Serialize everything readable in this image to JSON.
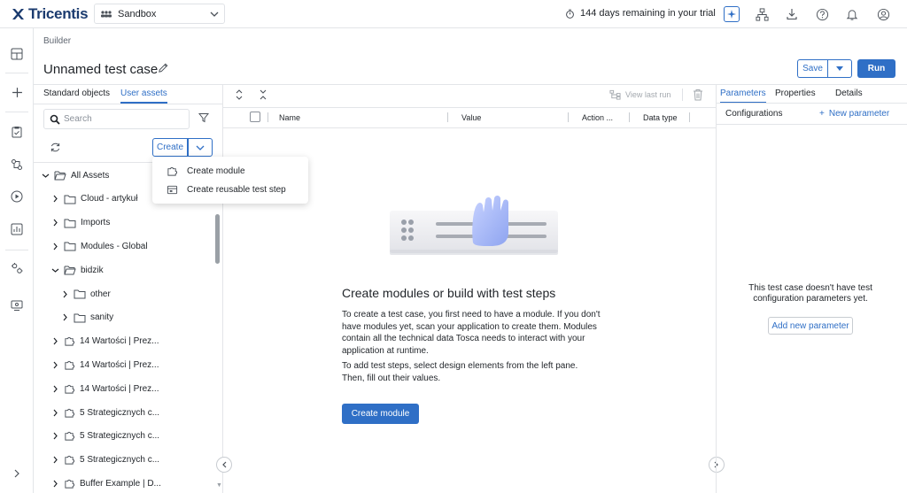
{
  "app": {
    "brand": "Tricentis",
    "workspace": "Sandbox",
    "trial_text": "144 days remaining in your trial"
  },
  "header": {
    "breadcrumb": "Builder",
    "title": "Unnamed test case",
    "save_label": "Save",
    "run_label": "Run"
  },
  "left_pane": {
    "tabs": [
      "Standard objects",
      "User assets"
    ],
    "active_tab": "User assets",
    "search_placeholder": "Search",
    "create_label": "Create",
    "tree": [
      {
        "label": "All Assets",
        "type": "folder",
        "expanded": true
      },
      {
        "label": "Cloud - artykuł",
        "type": "folder"
      },
      {
        "label": "Imports",
        "type": "folder"
      },
      {
        "label": "Modules - Global",
        "type": "folder"
      },
      {
        "label": "bidzik",
        "type": "folder",
        "expanded": true
      },
      {
        "label": "other",
        "type": "folder"
      },
      {
        "label": "sanity",
        "type": "folder"
      },
      {
        "label": "14 Wartości | Prez...",
        "type": "module"
      },
      {
        "label": "14 Wartości | Prez...",
        "type": "module"
      },
      {
        "label": "14 Wartości | Prez...",
        "type": "module"
      },
      {
        "label": "5 Strategicznych c...",
        "type": "module"
      },
      {
        "label": "5 Strategicznych c...",
        "type": "module"
      },
      {
        "label": "5 Strategicznych c...",
        "type": "module"
      },
      {
        "label": "Buffer Example | D...",
        "type": "module"
      }
    ]
  },
  "create_menu": {
    "items": [
      "Create module",
      "Create reusable test step"
    ]
  },
  "center": {
    "view_last_run": "View last run",
    "columns": [
      "Name",
      "Value",
      "Action ...",
      "Data type"
    ],
    "empty_title": "Create modules or build with test steps",
    "empty_para1": "To create a test case, you first need to have a module. If you don't have modules yet, scan your application to create them. Modules contain all the technical data Tosca needs to interact with your application at runtime.",
    "empty_para2": "To add test steps, select design elements from the left pane. Then, fill out their values.",
    "create_module_label": "Create module"
  },
  "right_pane": {
    "tabs": [
      "Parameters",
      "Properties",
      "Details"
    ],
    "active_tab": "Parameters",
    "configurations_label": "Configurations",
    "new_parameter_label": "New parameter",
    "empty_text": "This test case doesn't have test configuration parameters yet.",
    "add_param_label": "Add new parameter"
  },
  "colors": {
    "accent": "#2f6fc6",
    "brand": "#1b3b6f",
    "border": "#e3e5e8"
  }
}
